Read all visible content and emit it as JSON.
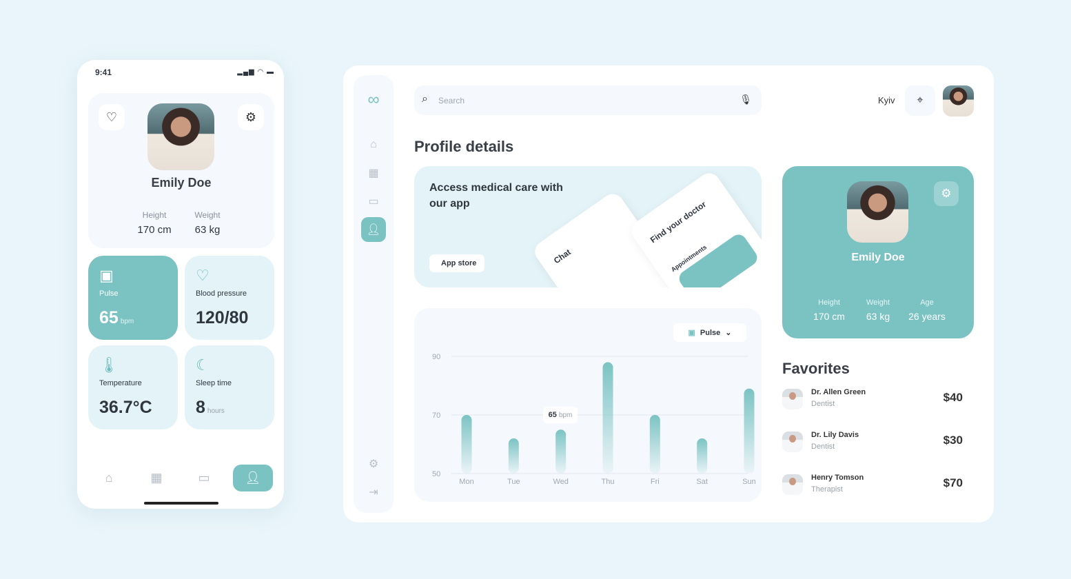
{
  "colors": {
    "accent": "#7bc3c3",
    "background": "#e9f5fa",
    "tile": "#e3f3f8"
  },
  "phone": {
    "status_time": "9:41",
    "profile": {
      "name": "Emily Doe",
      "height_label": "Height",
      "height": "170 cm",
      "weight_label": "Weight",
      "weight": "63 kg"
    },
    "tiles": [
      {
        "icon": "clipboard-pulse-icon",
        "label": "Pulse",
        "value": "65",
        "unit": "bpm"
      },
      {
        "icon": "heart-rate-icon",
        "label": "Blood pressure",
        "value": "120/80",
        "unit": ""
      },
      {
        "icon": "thermometer-icon",
        "label": "Temperature",
        "value": "36.7°C",
        "unit": ""
      },
      {
        "icon": "moon-stars-icon",
        "label": "Sleep time",
        "value": "8",
        "unit": "hours"
      }
    ],
    "nav": [
      "home-icon",
      "calendar-icon",
      "chat-icon",
      "user-icon"
    ]
  },
  "dashboard": {
    "search_placeholder": "Search",
    "city": "Kyiv",
    "page_title": "Profile details",
    "promo": {
      "title": "Access medical care with our app",
      "button": "App store",
      "mock_chat_title": "Chat",
      "mock_doctor_title": "Find your doctor",
      "mock_appointments": "Appointments"
    },
    "chart_selector": "Pulse",
    "tooltip": {
      "value": "65",
      "unit": "bpm"
    },
    "profile_card": {
      "name": "Emily Doe",
      "height_label": "Height",
      "height": "170 cm",
      "weight_label": "Weight",
      "weight": "63 kg",
      "age_label": "Age",
      "age": "26 years"
    },
    "favorites_title": "Favorites",
    "favorites": [
      {
        "name": "Dr. Allen Green",
        "role": "Dentist",
        "price": "$40"
      },
      {
        "name": "Dr. Lily Davis",
        "role": "Dentist",
        "price": "$30"
      },
      {
        "name": "Henry Tomson",
        "role": "Therapist",
        "price": "$70"
      }
    ]
  },
  "chart_data": {
    "type": "bar",
    "categories": [
      "Mon",
      "Tue",
      "Wed",
      "Thu",
      "Fri",
      "Sat",
      "Sun"
    ],
    "values": [
      70,
      62,
      65,
      88,
      70,
      62,
      79
    ],
    "yticks": [
      90,
      70,
      50
    ],
    "ylim": [
      50,
      90
    ],
    "grid": true
  }
}
